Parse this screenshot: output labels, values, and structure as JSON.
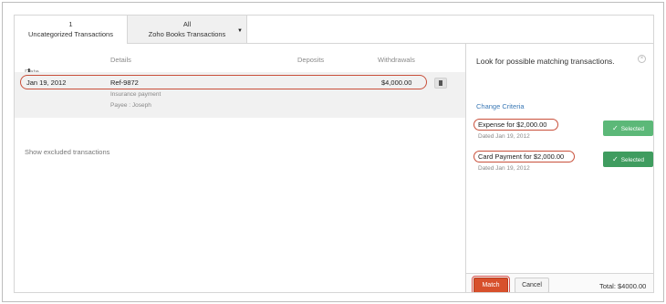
{
  "tabs": [
    {
      "count": "1",
      "label": "Uncategorized Transactions"
    },
    {
      "count": "All",
      "label": "Zoho Books Transactions"
    }
  ],
  "columns": {
    "date": "Date",
    "details": "Details",
    "deposits": "Deposits",
    "withdrawals": "Withdrawals"
  },
  "transaction": {
    "date": "Jan 19, 2012",
    "ref": "Ref-9872",
    "description": "Insurance payment",
    "payee": "Payee : Joseph",
    "deposits": "",
    "withdrawal": "$4,000.00"
  },
  "show_excluded": "Show excluded transactions",
  "panel": {
    "title": "Look for possible matching transactions.",
    "close_glyph": "×",
    "change_criteria": "Change Criteria",
    "matches": [
      {
        "title": "Expense for $2,000.00",
        "date": "Dated Jan 19, 2012",
        "button": "Selected"
      },
      {
        "title": "Card Payment for $2,000.00",
        "date": "Dated Jan 19, 2012",
        "button": "Selected"
      }
    ],
    "match_button": "Match",
    "cancel_button": "Cancel",
    "total": "Total: $4000.00"
  },
  "colors": {
    "accent_red": "#d7502c",
    "highlight_oval": "#c9503b",
    "selected_green_1": "#5cb878",
    "selected_green_2": "#3f9c5f",
    "link_blue": "#3a78b5"
  }
}
